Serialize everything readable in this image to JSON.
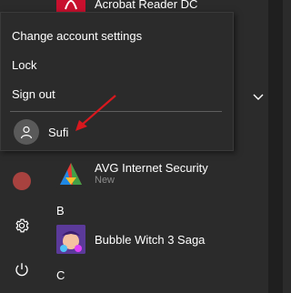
{
  "flyout": {
    "change_account_settings": "Change account settings",
    "lock": "Lock",
    "sign_out": "Sign out",
    "user_name": "Sufi"
  },
  "apps": {
    "acrobat": {
      "name": "Acrobat Reader DC"
    },
    "avg": {
      "name": "AVG Internet Security",
      "status": "New"
    },
    "bubble": {
      "name": "Bubble Witch 3 Saga"
    }
  },
  "letters": {
    "b": "B",
    "c": "C"
  },
  "icons": {
    "settings": "gear-icon",
    "power": "power-icon",
    "avatar": "user-icon",
    "chevron": "chevron-down-icon"
  },
  "colors": {
    "background": "#2b2b2b",
    "accent_arrow": "#d9181e",
    "profile_dot": "#a8423f"
  }
}
